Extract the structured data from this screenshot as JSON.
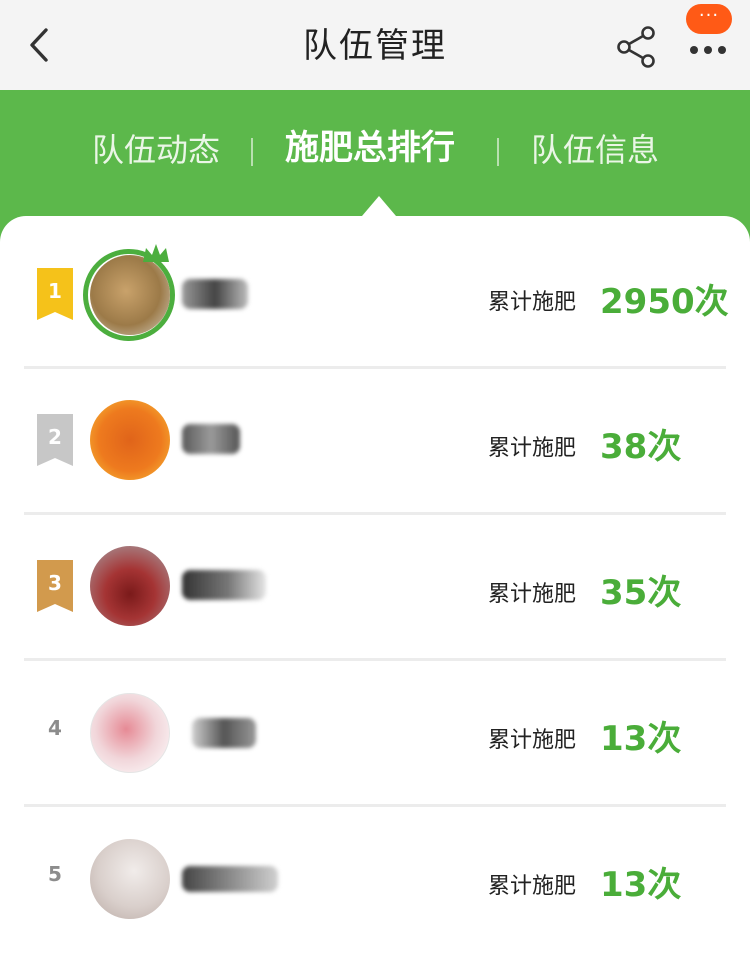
{
  "header": {
    "title": "队伍管理",
    "more_badge": "···",
    "back_icon": "chevron-left-icon",
    "share_icon": "share-icon",
    "more_icon": "more-icon"
  },
  "tabs": [
    {
      "label": "队伍动态",
      "active": false
    },
    {
      "label": "施肥总排行",
      "active": true
    },
    {
      "label": "队伍信息",
      "active": false
    }
  ],
  "ranking": [
    {
      "rank": "1",
      "stat_label": "累计施肥",
      "value": "2950次",
      "ribbon_color": "#f5c21a",
      "avatar_color": "#b9915a"
    },
    {
      "rank": "2",
      "stat_label": "累计施肥",
      "value": "38次",
      "ribbon_color": "#c7c7c7",
      "avatar_color": "#ee7a1e"
    },
    {
      "rank": "3",
      "stat_label": "累计施肥",
      "value": "35次",
      "ribbon_color": "#d29a4d",
      "avatar_color": "#8d3a35"
    },
    {
      "rank": "4",
      "stat_label": "累计施肥",
      "value": "13次",
      "avatar_color": "#f1d6da"
    },
    {
      "rank": "5",
      "stat_label": "累计施肥",
      "value": "13次",
      "avatar_color": "#d9cfcb"
    }
  ],
  "colors": {
    "accent_green": "#5cb84b",
    "value_green": "#4aad39",
    "badge_orange": "#ff5a16"
  }
}
